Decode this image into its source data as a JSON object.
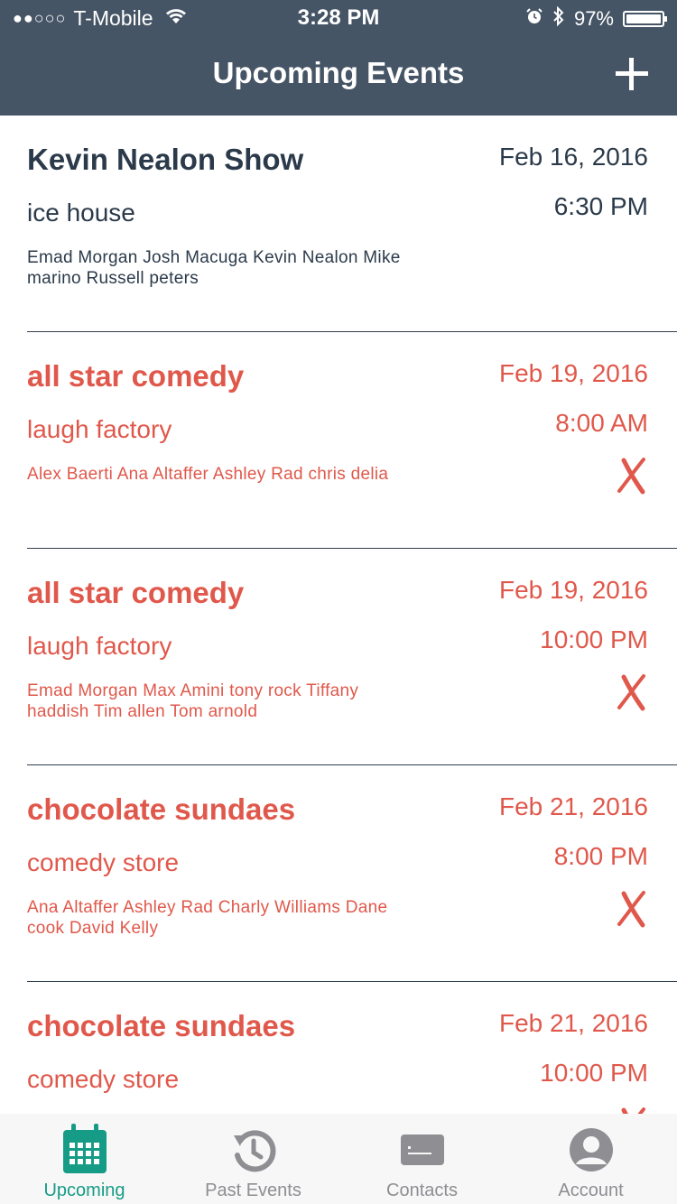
{
  "status_bar": {
    "signal": "●●○○○",
    "carrier": "T-Mobile",
    "time": "3:28 PM",
    "battery": "97%"
  },
  "header": {
    "title": "Upcoming Events",
    "add_icon": "plus-icon"
  },
  "events": [
    {
      "name": "Kevin Nealon Show",
      "venue": "ice house",
      "performers": "Emad Morgan Josh Macuga Kevin Nealon Mike marino Russell peters",
      "date": "Feb 16, 2016",
      "time": "6:30 PM",
      "cancelled": false
    },
    {
      "name": "all star comedy",
      "venue": "laugh factory",
      "performers": "Alex Baerti Ana Altaffer Ashley Rad chris delia",
      "date": "Feb 19, 2016",
      "time": "8:00 AM",
      "cancelled": true
    },
    {
      "name": "all star comedy",
      "venue": "laugh factory",
      "performers": "Emad Morgan Max Amini tony rock Tiffany haddish Tim allen Tom arnold",
      "date": "Feb 19, 2016",
      "time": "10:00 PM",
      "cancelled": true
    },
    {
      "name": "chocolate sundaes",
      "venue": "comedy store",
      "performers": "Ana Altaffer Ashley Rad Charly Williams Dane cook David Kelly",
      "date": "Feb 21, 2016",
      "time": "8:00 PM",
      "cancelled": true
    },
    {
      "name": "chocolate sundaes",
      "venue": "comedy store",
      "performers": "",
      "date": "Feb 21, 2016",
      "time": "10:00 PM",
      "cancelled": true
    }
  ],
  "tabs": [
    {
      "label": "Upcoming",
      "icon": "calendar-icon",
      "active": true
    },
    {
      "label": "Past Events",
      "icon": "history-icon",
      "active": false
    },
    {
      "label": "Contacts",
      "icon": "contact-card-icon",
      "active": false
    },
    {
      "label": "Account",
      "icon": "user-icon",
      "active": false
    }
  ],
  "colors": {
    "header": "#465566",
    "active_event": "#2b3a4a",
    "cancelled_event": "#e0584b",
    "tab_active": "#169c86",
    "tab_inactive": "#8e8e93"
  }
}
